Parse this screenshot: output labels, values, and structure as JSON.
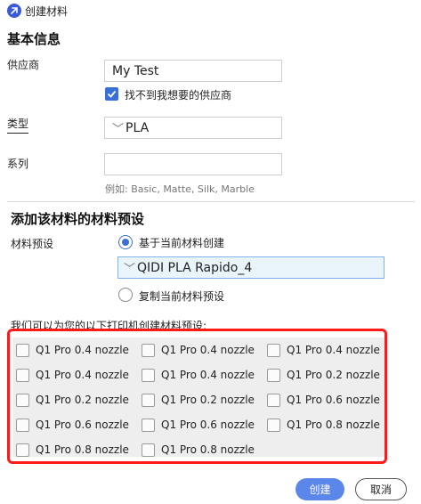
{
  "window": {
    "title": "创建材料",
    "accent": "#3a6fd8"
  },
  "basic_info": {
    "section_title": "基本信息",
    "vendor": {
      "label": "供应商",
      "value": "My Test"
    },
    "vendor_not_found": {
      "label": "找不到我想要的供应商",
      "checked": true
    },
    "type": {
      "label": "类型",
      "value": "PLA"
    },
    "series": {
      "label": "系列",
      "value": "",
      "hint": "例如:  Basic, Matte, Silk, Marble"
    }
  },
  "preset_section": {
    "section_title": "添加该材料的材料预设",
    "preset_label": "材料预设",
    "option_create": {
      "label": "基于当前材料创建",
      "selected": true
    },
    "current_material": "QIDI PLA Rapido_4",
    "option_copy": {
      "label": "复制当前材料预设",
      "selected": false
    }
  },
  "printers": {
    "prompt": "我们可以为您的以下打印机创建材料预设:",
    "highlight_color": "#ff1a1a",
    "items": [
      {
        "label": "Q1 Pro 0.4 nozzle",
        "checked": false
      },
      {
        "label": "Q1 Pro 0.4 nozzle",
        "checked": false
      },
      {
        "label": "Q1 Pro 0.4 nozzle",
        "checked": false
      },
      {
        "label": "Q1 Pro 0.4 nozzle",
        "checked": false
      },
      {
        "label": "Q1 Pro 0.4 nozzle",
        "checked": false
      },
      {
        "label": "Q1 Pro 0.2 nozzle",
        "checked": false
      },
      {
        "label": "Q1 Pro 0.2 nozzle",
        "checked": false
      },
      {
        "label": "Q1 Pro 0.2 nozzle",
        "checked": false
      },
      {
        "label": "Q1 Pro 0.6 nozzle",
        "checked": false
      },
      {
        "label": "Q1 Pro 0.6 nozzle",
        "checked": false
      },
      {
        "label": "Q1 Pro 0.6 nozzle",
        "checked": false
      },
      {
        "label": "Q1 Pro 0.8 nozzle",
        "checked": false
      },
      {
        "label": "Q1 Pro 0.8 nozzle",
        "checked": false
      },
      {
        "label": "Q1 Pro 0.8 nozzle",
        "checked": false
      }
    ]
  },
  "footer": {
    "create_label": "创建",
    "cancel_label": "取消"
  }
}
